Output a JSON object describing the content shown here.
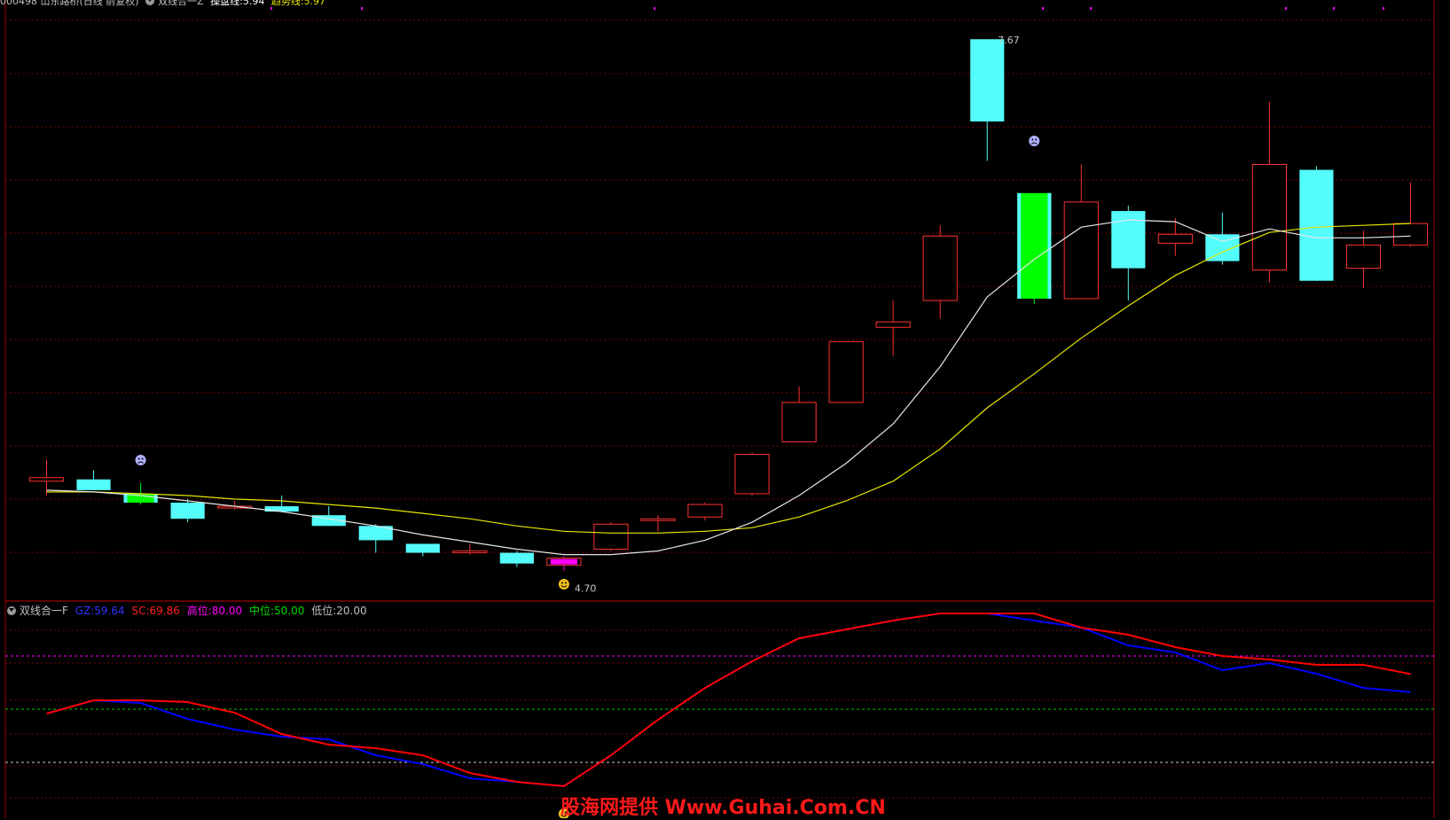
{
  "header_main": {
    "code_title": "000498 山东路桥(日线 前复权)",
    "indicator_name": "双线合一Z",
    "op_label": "操盘线:",
    "op_value": "5.94",
    "trend_label": "趋势线:",
    "trend_value": "5.97"
  },
  "header_sub": {
    "indicator_name": "双线合一F",
    "gz_label": "GZ:",
    "gz_value": "59.64",
    "sc_label": "SC:",
    "sc_value": "69.86",
    "high_label": "高位:",
    "high_value": "80.00",
    "mid_label": "中位:",
    "mid_value": "50.00",
    "low_label": "低位:",
    "low_value": "20.00"
  },
  "watermark": "股海网提供 Www.Guhai.Com.CN",
  "colors": {
    "up": "#ff3232",
    "down": "#54fcfc",
    "op_line": "#e6e6e6",
    "trend_line": "#e6e600",
    "gz_line": "#0000ff",
    "sc_line": "#ff0000",
    "high_line": "#ff00ff",
    "mid_line": "#00cc00",
    "low_line": "#cccccc",
    "grid": "#7a0000"
  },
  "chart_data": [
    {
      "type": "candlestick",
      "ylim": [
        4.56,
        7.79
      ],
      "annotations": {
        "max_label": "7.67",
        "min_label": "4.70"
      },
      "candles": [
        {
          "o": 5.2,
          "h": 5.32,
          "l": 5.12,
          "c": 5.22,
          "d": "up"
        },
        {
          "o": 5.21,
          "h": 5.26,
          "l": 5.17,
          "c": 5.15,
          "d": "down"
        },
        {
          "o": 5.13,
          "h": 5.19,
          "l": 5.07,
          "c": 5.08,
          "d": "hl"
        },
        {
          "o": 5.08,
          "h": 5.1,
          "l": 4.97,
          "c": 4.99,
          "d": "down"
        },
        {
          "o": 5.05,
          "h": 5.09,
          "l": 5.04,
          "c": 5.06,
          "d": "up"
        },
        {
          "o": 5.06,
          "h": 5.12,
          "l": 5.04,
          "c": 5.03,
          "d": "down"
        },
        {
          "o": 5.01,
          "h": 5.06,
          "l": 4.96,
          "c": 4.95,
          "d": "down"
        },
        {
          "o": 4.95,
          "h": 4.96,
          "l": 4.8,
          "c": 4.87,
          "d": "down"
        },
        {
          "o": 4.85,
          "h": 4.85,
          "l": 4.78,
          "c": 4.8,
          "d": "down"
        },
        {
          "o": 4.8,
          "h": 4.85,
          "l": 4.79,
          "c": 4.81,
          "d": "up"
        },
        {
          "o": 4.8,
          "h": 4.81,
          "l": 4.72,
          "c": 4.74,
          "d": "down"
        },
        {
          "o": 4.73,
          "h": 4.78,
          "l": 4.7,
          "c": 4.77,
          "d": "mg"
        },
        {
          "o": 4.82,
          "h": 4.97,
          "l": 4.81,
          "c": 4.96,
          "d": "up"
        },
        {
          "o": 4.98,
          "h": 5.01,
          "l": 4.92,
          "c": 4.99,
          "d": "up"
        },
        {
          "o": 5.0,
          "h": 5.08,
          "l": 4.98,
          "c": 5.07,
          "d": "up"
        },
        {
          "o": 5.13,
          "h": 5.36,
          "l": 5.12,
          "c": 5.35,
          "d": "up"
        },
        {
          "o": 5.42,
          "h": 5.73,
          "l": 5.42,
          "c": 5.64,
          "d": "up"
        },
        {
          "o": 5.64,
          "h": 5.98,
          "l": 5.64,
          "c": 5.98,
          "d": "up"
        },
        {
          "o": 6.06,
          "h": 6.21,
          "l": 5.9,
          "c": 6.09,
          "d": "up"
        },
        {
          "o": 6.21,
          "h": 6.63,
          "l": 6.11,
          "c": 6.57,
          "d": "up"
        },
        {
          "o": 7.67,
          "h": 7.67,
          "l": 6.99,
          "c": 7.21,
          "d": "down"
        },
        {
          "o": 6.81,
          "h": 6.81,
          "l": 6.19,
          "c": 6.22,
          "d": "hl"
        },
        {
          "o": 6.22,
          "h": 6.97,
          "l": 6.22,
          "c": 6.76,
          "d": "up"
        },
        {
          "o": 6.71,
          "h": 6.74,
          "l": 6.21,
          "c": 6.39,
          "d": "down"
        },
        {
          "o": 6.53,
          "h": 6.67,
          "l": 6.46,
          "c": 6.58,
          "d": "up"
        },
        {
          "o": 6.58,
          "h": 6.7,
          "l": 6.41,
          "c": 6.43,
          "d": "down"
        },
        {
          "o": 6.38,
          "h": 7.32,
          "l": 6.31,
          "c": 6.97,
          "d": "up"
        },
        {
          "o": 6.94,
          "h": 6.96,
          "l": 6.33,
          "c": 6.32,
          "d": "down"
        },
        {
          "o": 6.39,
          "h": 6.6,
          "l": 6.28,
          "c": 6.52,
          "d": "up"
        },
        {
          "o": 6.52,
          "h": 6.87,
          "l": 6.51,
          "c": 6.64,
          "d": "up"
        }
      ],
      "series": [
        {
          "name": "操盘线",
          "values": [
            5.15,
            5.14,
            5.12,
            5.09,
            5.06,
            5.03,
            4.99,
            4.95,
            4.9,
            4.86,
            4.82,
            4.79,
            4.79,
            4.81,
            4.87,
            4.97,
            5.12,
            5.3,
            5.52,
            5.84,
            6.23,
            6.44,
            6.62,
            6.66,
            6.65,
            6.54,
            6.61,
            6.56,
            6.56,
            6.57
          ]
        },
        {
          "name": "趋势线",
          "values": [
            5.14,
            5.14,
            5.13,
            5.12,
            5.1,
            5.09,
            5.07,
            5.05,
            5.02,
            4.99,
            4.95,
            4.92,
            4.91,
            4.91,
            4.92,
            4.94,
            5.0,
            5.09,
            5.2,
            5.38,
            5.61,
            5.8,
            6.0,
            6.18,
            6.35,
            6.48,
            6.59,
            6.62,
            6.63,
            6.64
          ]
        }
      ]
    },
    {
      "type": "line",
      "ylim": [
        0,
        100
      ],
      "series": [
        {
          "name": "GZ",
          "values": [
            47.5,
            55,
            53.5,
            44.5,
            38.5,
            34.5,
            33,
            24,
            19,
            11,
            9,
            6.6,
            24,
            44,
            62,
            77,
            90,
            95,
            100,
            104,
            104,
            100,
            96,
            86,
            82,
            72,
            76,
            70,
            62,
            59.64
          ]
        },
        {
          "name": "SC",
          "values": [
            47.5,
            55,
            55,
            54,
            48,
            36,
            30,
            28,
            24,
            14,
            9,
            6.6,
            24,
            44,
            62,
            77,
            90,
            95,
            100,
            104,
            104,
            104,
            96,
            92,
            85,
            80,
            78,
            75,
            75,
            69.86
          ]
        }
      ],
      "reference_lines": [
        80,
        50,
        20
      ]
    }
  ]
}
